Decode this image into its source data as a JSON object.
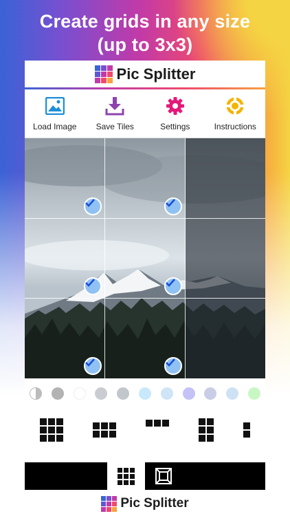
{
  "headline": {
    "line1": "Create grids in any size",
    "line2": "(up to 3x3)"
  },
  "app": {
    "brand": "Pic Splitter"
  },
  "toolbar": {
    "load": "Load Image",
    "save": "Save Tiles",
    "settings": "Settings",
    "instructions": "Instructions"
  },
  "colors": {
    "load_icon": "#1f8fd6",
    "save_icon": "#8e44ad",
    "settings_icon": "#e5197a",
    "instructions_icon": "#f4b400",
    "check": "#1a4fd6"
  },
  "swatches": [
    "#e6e6e6",
    "#b3b3b3",
    "#ffffff",
    "#c9ccd1",
    "#c2c7cc",
    "#c8e9fb",
    "#cfe4f7",
    "#c4c2f7",
    "#c9cde6",
    "#cfe2f5",
    "#c9f7c4"
  ],
  "grid_options": [
    "3x3",
    "3x2",
    "3x1",
    "2x3",
    "1x3"
  ],
  "footer": {
    "brand": "Pic Splitter"
  }
}
